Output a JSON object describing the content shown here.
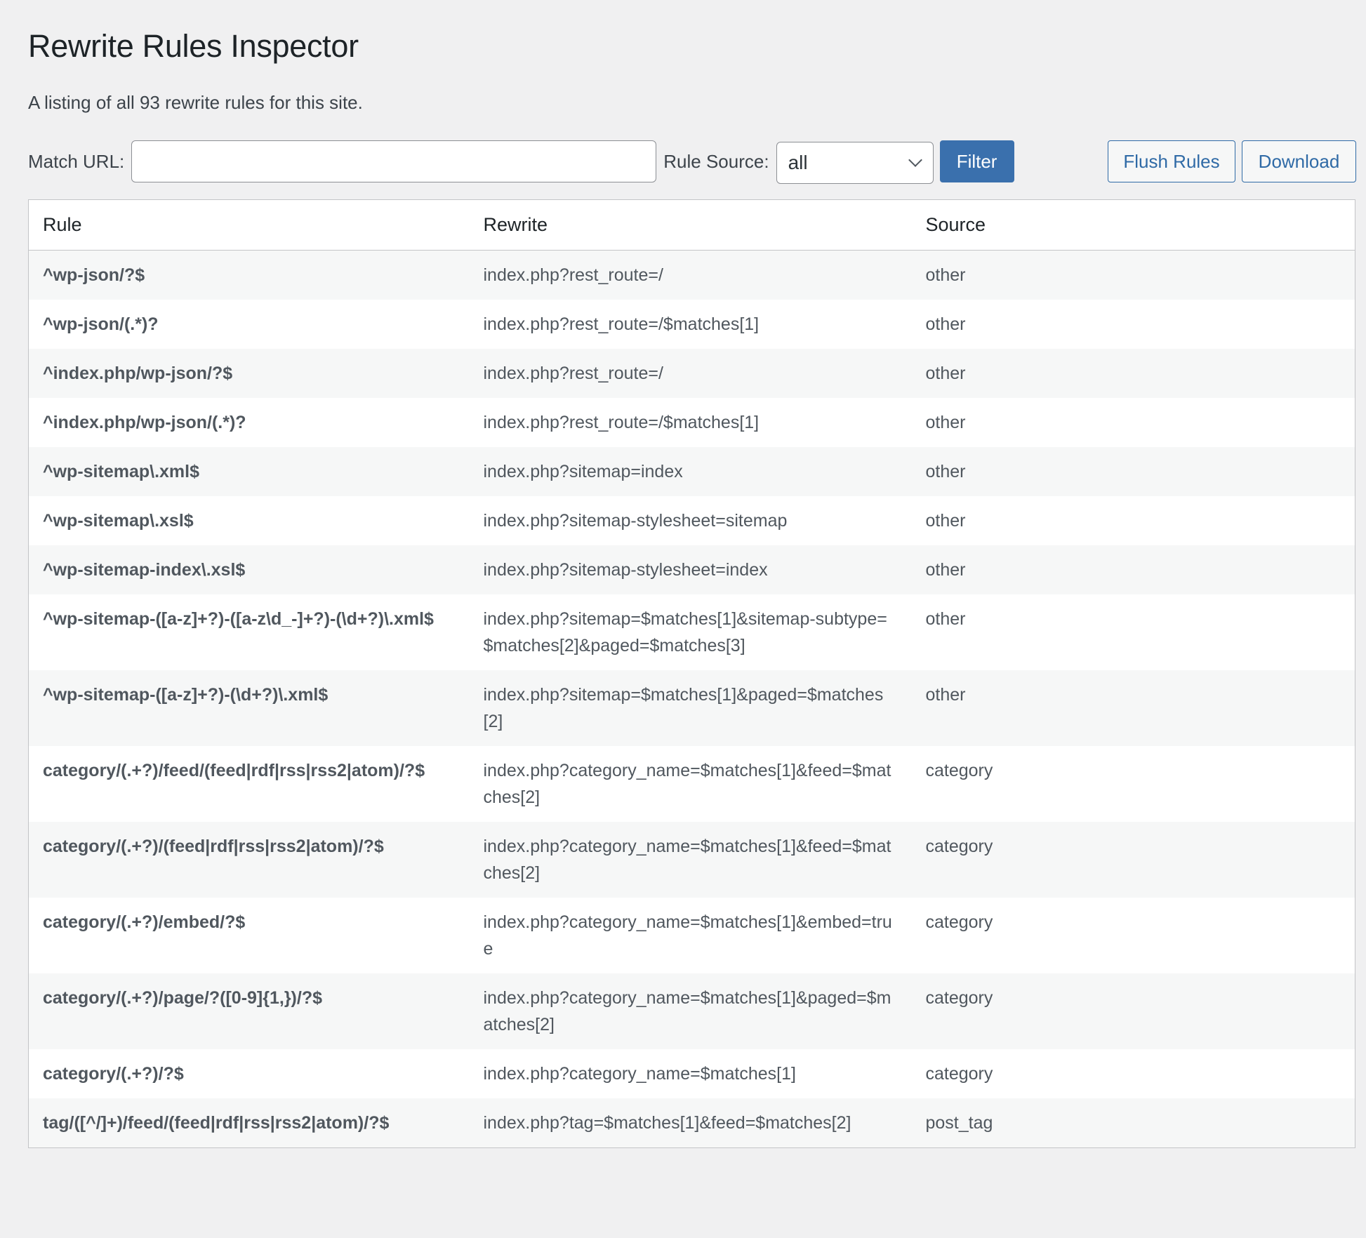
{
  "page": {
    "title": "Rewrite Rules Inspector",
    "description": "A listing of all 93 rewrite rules for this site."
  },
  "toolbar": {
    "match_url_label": "Match URL:",
    "match_url_value": "",
    "match_url_placeholder": "",
    "rule_source_label": "Rule Source:",
    "rule_source_selected": "all",
    "filter_label": "Filter",
    "flush_label": "Flush Rules",
    "download_label": "Download"
  },
  "table": {
    "headers": [
      "Rule",
      "Rewrite",
      "Source"
    ],
    "rows": [
      {
        "rule": "^wp-json/?$",
        "rewrite": "index.php?rest_route=/",
        "source": "other"
      },
      {
        "rule": "^wp-json/(.*)?",
        "rewrite": "index.php?rest_route=/$matches[1]",
        "source": "other"
      },
      {
        "rule": "^index.php/wp-json/?$",
        "rewrite": "index.php?rest_route=/",
        "source": "other"
      },
      {
        "rule": "^index.php/wp-json/(.*)?",
        "rewrite": "index.php?rest_route=/$matches[1]",
        "source": "other"
      },
      {
        "rule": "^wp-sitemap\\.xml$",
        "rewrite": "index.php?sitemap=index",
        "source": "other"
      },
      {
        "rule": "^wp-sitemap\\.xsl$",
        "rewrite": "index.php?sitemap-stylesheet=sitemap",
        "source": "other"
      },
      {
        "rule": "^wp-sitemap-index\\.xsl$",
        "rewrite": "index.php?sitemap-stylesheet=index",
        "source": "other"
      },
      {
        "rule": "^wp-sitemap-([a-z]+?)-([a-z\\d_-]+?)-(\\d+?)\\.xml$",
        "rewrite": "index.php?sitemap=$matches[1]&sitemap-subtype=$matches[2]&paged=$matches[3]",
        "source": "other"
      },
      {
        "rule": "^wp-sitemap-([a-z]+?)-(\\d+?)\\.xml$",
        "rewrite": "index.php?sitemap=$matches[1]&paged=$matches[2]",
        "source": "other"
      },
      {
        "rule": "category/(.+?)/feed/(feed|rdf|rss|rss2|atom)/?$",
        "rewrite": "index.php?category_name=$matches[1]&feed=$matches[2]",
        "source": "category"
      },
      {
        "rule": "category/(.+?)/(feed|rdf|rss|rss2|atom)/?$",
        "rewrite": "index.php?category_name=$matches[1]&feed=$matches[2]",
        "source": "category"
      },
      {
        "rule": "category/(.+?)/embed/?$",
        "rewrite": "index.php?category_name=$matches[1]&embed=true",
        "source": "category"
      },
      {
        "rule": "category/(.+?)/page/?([0-9]{1,})/?$",
        "rewrite": "index.php?category_name=$matches[1]&paged=$matches[2]",
        "source": "category"
      },
      {
        "rule": "category/(.+?)/?$",
        "rewrite": "index.php?category_name=$matches[1]",
        "source": "category"
      },
      {
        "rule": "tag/([^/]+)/feed/(feed|rdf|rss|rss2|atom)/?$",
        "rewrite": "index.php?tag=$matches[1]&feed=$matches[2]",
        "source": "post_tag"
      }
    ]
  }
}
